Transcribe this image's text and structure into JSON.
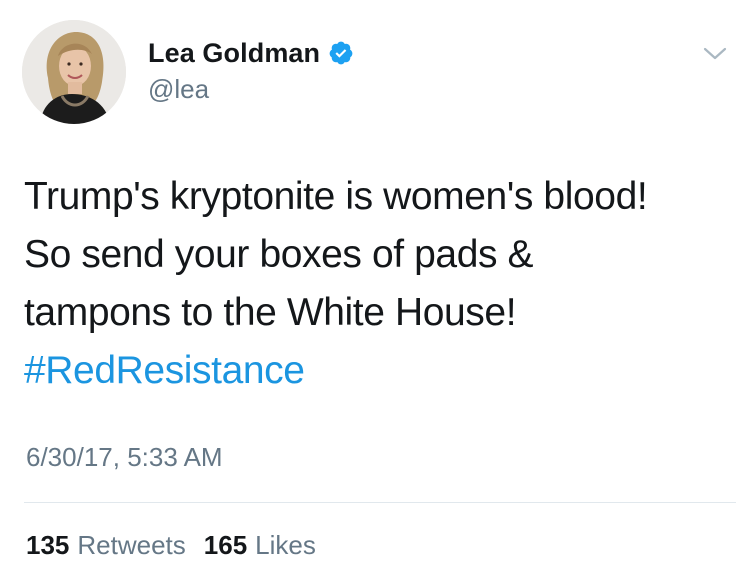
{
  "author": {
    "display_name": "Lea Goldman",
    "handle": "@lea",
    "verified": true,
    "verified_icon": "verified-badge-icon"
  },
  "tweet": {
    "lines": [
      "Trump's kryptonite is women's blood!",
      "So send your boxes of pads &",
      "tampons to the White House!"
    ],
    "hashtag": "#RedResistance",
    "timestamp": "6/30/17, 5:33 AM"
  },
  "stats": {
    "retweets_count": "135",
    "retweets_label": "Retweets",
    "likes_count": "165",
    "likes_label": "Likes"
  },
  "colors": {
    "link": "#1b95e0",
    "secondary_text": "#657786",
    "primary_text": "#14171a",
    "divider": "#e1e8ed"
  }
}
